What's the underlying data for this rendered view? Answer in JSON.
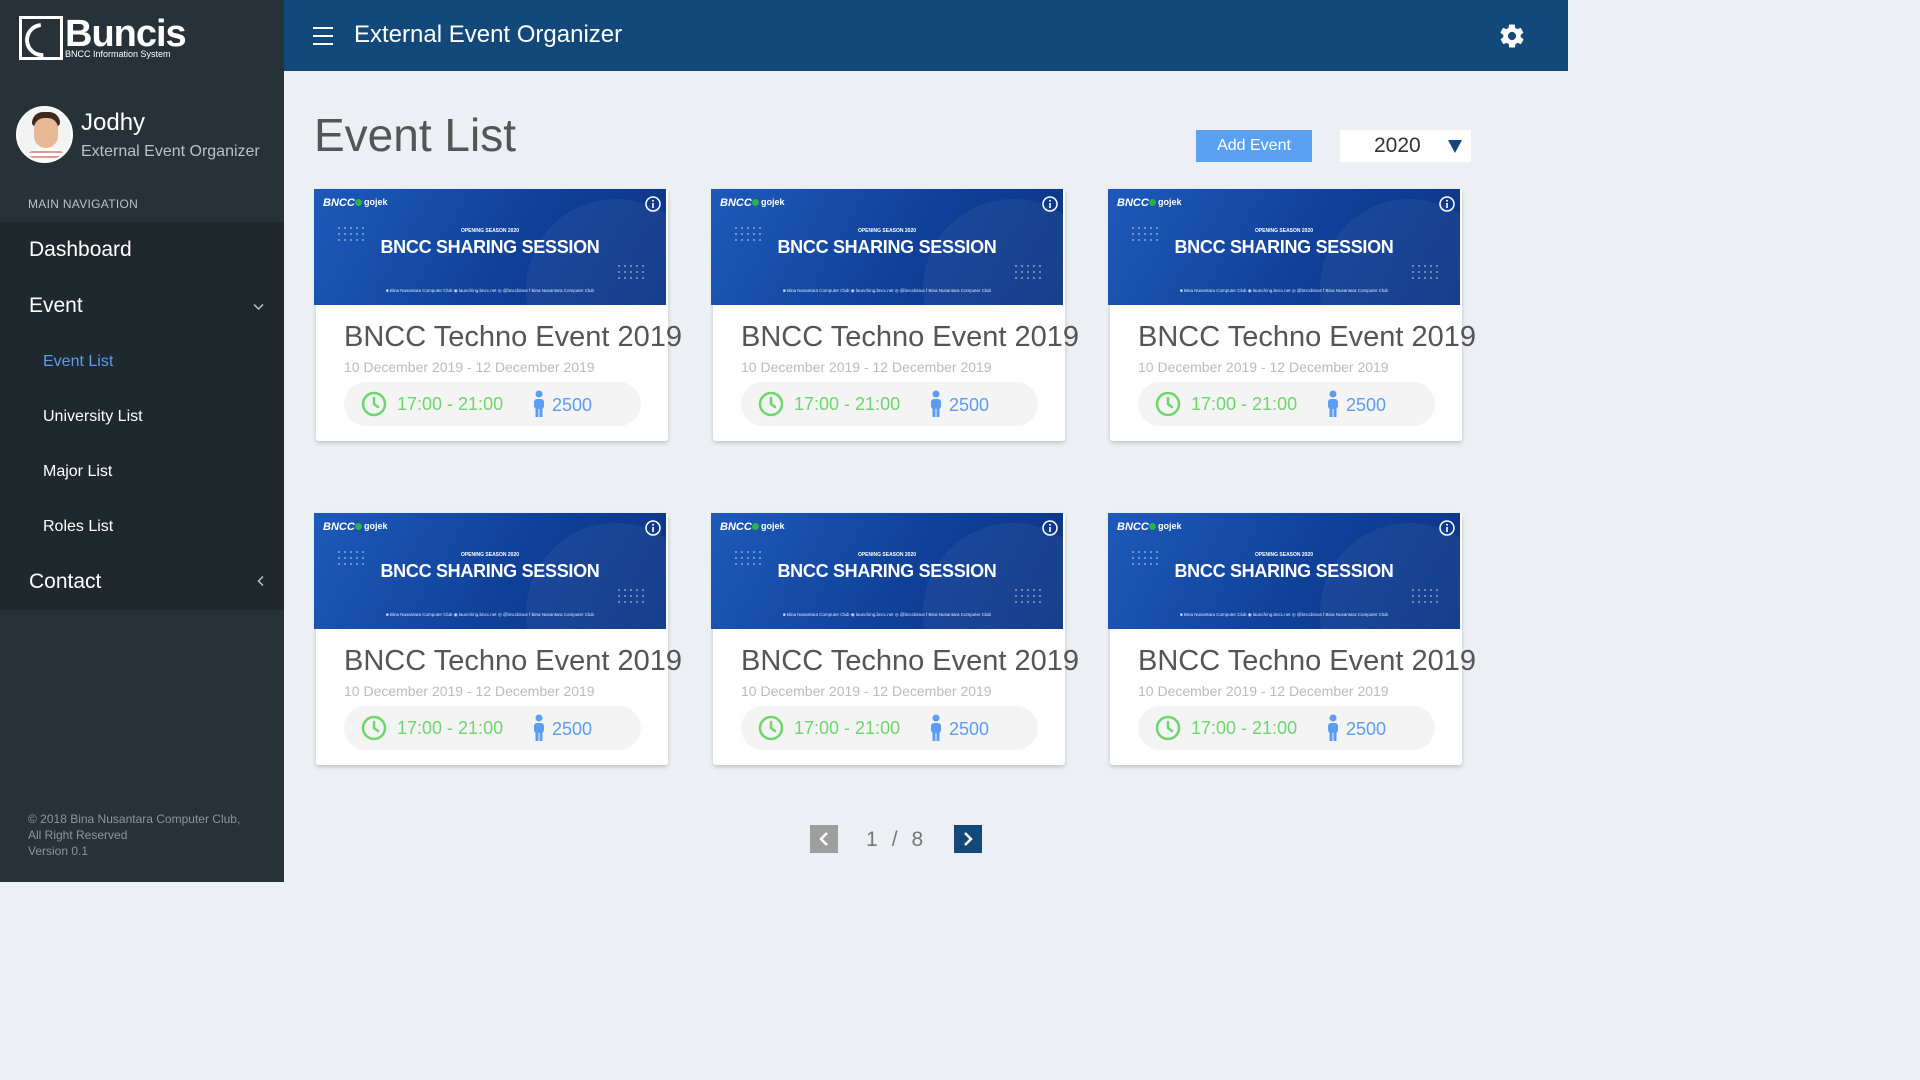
{
  "sidebar": {
    "logo_title": "Buncis",
    "logo_subtitle": "BNCC Information System",
    "user_name": "Jodhy",
    "user_role": "External Event Organizer",
    "nav_header": "MAIN NAVIGATION",
    "items": [
      {
        "label": "Dashboard"
      },
      {
        "label": "Event"
      },
      {
        "label": "Contact"
      }
    ],
    "sub_items": [
      {
        "label": "Event List"
      },
      {
        "label": "University List"
      },
      {
        "label": "Major List"
      },
      {
        "label": "Roles List"
      }
    ],
    "footer_line1": "© 2018 Bina Nusantara Computer Club,",
    "footer_line2": "All Right Reserved",
    "footer_line3": "Version 0.1"
  },
  "header": {
    "title": "External Event Organizer"
  },
  "main": {
    "page_title": "Event List",
    "add_button": "Add Event",
    "year": "2020"
  },
  "banner": {
    "brand": "BNCC",
    "partner": "gojek",
    "season": "OPENING SEASON 2020",
    "headline": "BNCC SHARING SESSION",
    "socials": "■ Bina Nusantara Computer Club   ◉ launching.bncc.net   ◎ @bnccbinus   f Bina Nusantara Computer Club"
  },
  "events": [
    {
      "title": "BNCC Techno Event 2019",
      "date": "10 December 2019 - 12 December 2019",
      "time": "17:00 - 21:00",
      "count": "2500"
    },
    {
      "title": "BNCC Techno Event 2019",
      "date": "10 December 2019 - 12 December 2019",
      "time": "17:00 - 21:00",
      "count": "2500"
    },
    {
      "title": "BNCC Techno Event 2019",
      "date": "10 December 2019 - 12 December 2019",
      "time": "17:00 - 21:00",
      "count": "2500"
    },
    {
      "title": "BNCC Techno Event 2019",
      "date": "10 December 2019 - 12 December 2019",
      "time": "17:00 - 21:00",
      "count": "2500"
    },
    {
      "title": "BNCC Techno Event 2019",
      "date": "10 December 2019 - 12 December 2019",
      "time": "17:00 - 21:00",
      "count": "2500"
    },
    {
      "title": "BNCC Techno Event 2019",
      "date": "10 December 2019 - 12 December 2019",
      "time": "17:00 - 21:00",
      "count": "2500"
    }
  ],
  "pagination": {
    "current": "1",
    "separator": "/",
    "total": "8"
  },
  "colors": {
    "sidebar_bg": "#263238",
    "topbar_bg": "#13497a",
    "accent_blue": "#5aa2f1",
    "time_green": "#6dd66d"
  }
}
